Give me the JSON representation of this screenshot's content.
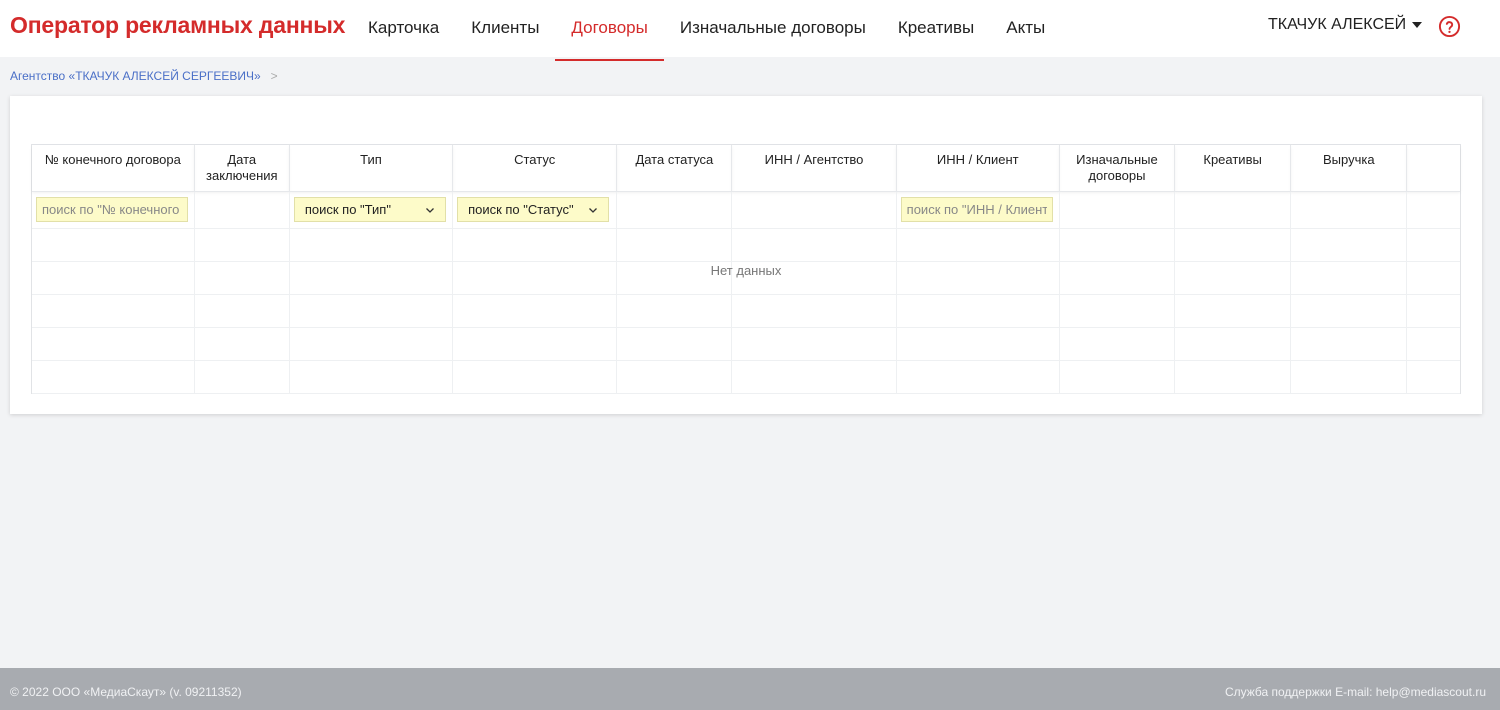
{
  "header": {
    "brand": "Оператор рекламных данных",
    "nav": [
      {
        "label": "Карточка",
        "active": false
      },
      {
        "label": "Клиенты",
        "active": false
      },
      {
        "label": "Договоры",
        "active": true
      },
      {
        "label": "Изначальные договоры",
        "active": false
      },
      {
        "label": "Креативы",
        "active": false
      },
      {
        "label": "Акты",
        "active": false
      }
    ],
    "user_name": "ТКАЧУК АЛЕКСЕЙ",
    "help_icon": "help-circle-icon",
    "accent_color": "#d42b2b"
  },
  "breadcrumb": {
    "item": "Агентство «ТКАЧУК АЛЕКСЕЙ СЕРГЕЕВИЧ»",
    "separator": ">"
  },
  "table": {
    "columns": [
      "№ конечного договора",
      "Дата заключения",
      "Тип",
      "Статус",
      "Дата статуса",
      "ИНН / Агентство",
      "ИНН / Клиент",
      "Изначальные договоры",
      "Креативы",
      "Выручка",
      ""
    ],
    "filters": {
      "contract_number_placeholder": "поиск по \"№ конечного договора\"",
      "type_value": "поиск по \"Тип\"",
      "status_value": "поиск по \"Статус\"",
      "client_inn_placeholder": "поиск по \"ИНН / Клиент\""
    },
    "empty_text": "Нет данных"
  },
  "footer": {
    "copyright": "© 2022 ООО «МедиаСкаут» (v. 09211352)",
    "support": "Служба поддержки E-mail: help@mediascout.ru"
  }
}
